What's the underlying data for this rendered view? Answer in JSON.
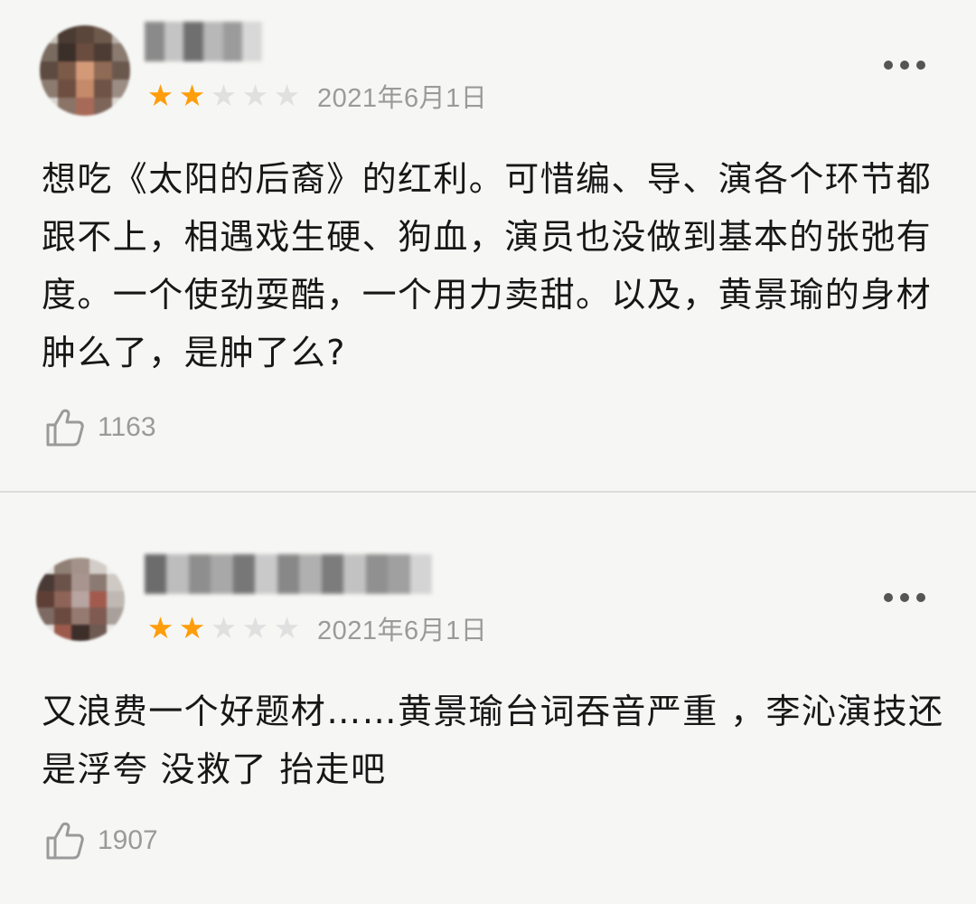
{
  "reviews": [
    {
      "rating": 2,
      "max_rating": 5,
      "date": "2021年6月1日",
      "content": "想吃《太阳的后裔》的红利。可惜编、导、演各个环节都跟不上，相遇戏生硬、狗血，演员也没做到基本的张弛有度。一个使劲耍酷，一个用力卖甜。以及，黄景瑜的身材肿么了，是肿了么?",
      "likes": "1163"
    },
    {
      "rating": 2,
      "max_rating": 5,
      "date": "2021年6月1日",
      "content": "又浪费一个好题材……黄景瑜台词吞音严重 ，李沁演技还是浮夸 没救了 抬走吧",
      "likes": "1907"
    }
  ],
  "icons": {
    "star": "star-icon",
    "more": "more-icon",
    "like": "thumbs-up-icon"
  },
  "colors": {
    "star_on": "#ff9d0a",
    "star_off": "#e0e0e0",
    "meta_text": "#9a9a9a",
    "body_text": "#171717",
    "background": "#f6f7f5"
  }
}
